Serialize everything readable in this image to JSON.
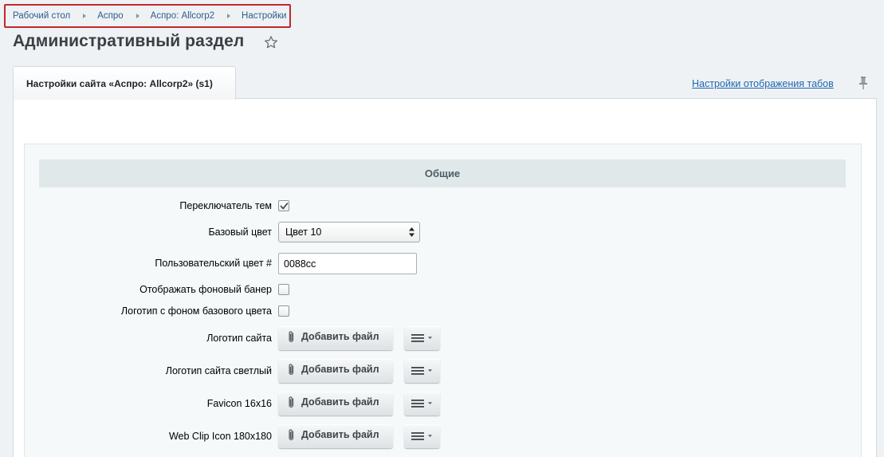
{
  "breadcrumbs": [
    "Рабочий стол",
    "Аспро",
    "Аспро: Allcorp2",
    "Настройки"
  ],
  "page_title": "Административный раздел",
  "tabs": [
    {
      "label": "Настройки сайта «Аспро: Allcorp2» (s1)",
      "active": true
    }
  ],
  "tabs_settings_link": "Настройки отображения табов",
  "section_title": "Общие",
  "fields": {
    "theme_switcher": {
      "label": "Переключатель тем",
      "checked": true
    },
    "base_color": {
      "label": "Базовый цвет",
      "value": "Цвет 10"
    },
    "custom_color": {
      "label": "Пользовательский цвет #",
      "value": "0088cc"
    },
    "show_bg_banner": {
      "label": "Отображать фоновый банер",
      "checked": false
    },
    "logo_base_bg": {
      "label": "Логотип с фоном базового цвета",
      "checked": false
    },
    "file_fields": [
      {
        "label": "Логотип сайта"
      },
      {
        "label": "Логотип сайта светлый"
      },
      {
        "label": "Favicon 16x16"
      },
      {
        "label": "Web Clip Icon 180x180"
      }
    ]
  },
  "add_file_label": "Добавить файл",
  "icons": {
    "crumb_separator": "triangle-right-icon",
    "favorite": "star-icon",
    "pin": "pin-icon",
    "attach": "paperclip-icon",
    "menu": "hamburger-dropdown-icon"
  },
  "colors": {
    "link": "#2167b3",
    "breadcrumb_highlight": "#c0282d",
    "section_header_bg": "#e0e8ea"
  }
}
